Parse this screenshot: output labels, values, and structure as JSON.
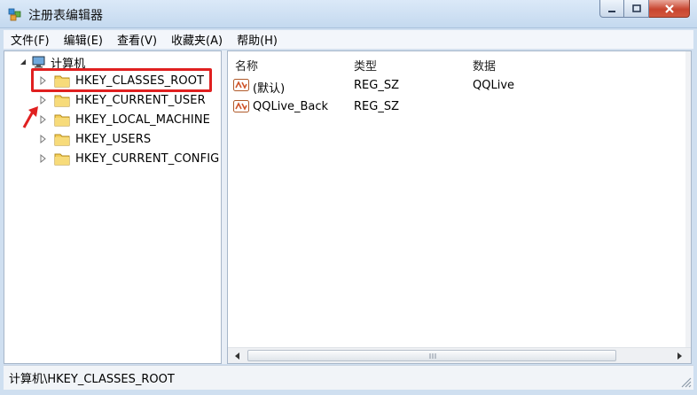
{
  "window": {
    "title": "注册表编辑器"
  },
  "menu": {
    "items": [
      {
        "label": "文件(F)"
      },
      {
        "label": "编辑(E)"
      },
      {
        "label": "查看(V)"
      },
      {
        "label": "收藏夹(A)"
      },
      {
        "label": "帮助(H)"
      }
    ]
  },
  "tree": {
    "root_label": "计算机",
    "items": [
      {
        "label": "HKEY_CLASSES_ROOT",
        "selected": true
      },
      {
        "label": "HKEY_CURRENT_USER"
      },
      {
        "label": "HKEY_LOCAL_MACHINE"
      },
      {
        "label": "HKEY_USERS"
      },
      {
        "label": "HKEY_CURRENT_CONFIG"
      }
    ]
  },
  "list": {
    "columns": [
      "名称",
      "类型",
      "数据"
    ],
    "rows": [
      {
        "name": "(默认)",
        "type": "REG_SZ",
        "data": "QQLive"
      },
      {
        "name": "QQLive_Back",
        "type": "REG_SZ",
        "data": ""
      }
    ]
  },
  "status": {
    "path": "计算机\\HKEY_CLASSES_ROOT"
  },
  "colors": {
    "highlight": "#e02020",
    "accent": "#2b6cb0"
  },
  "icons": {
    "app": "registry-editor-icon",
    "folder": "folder-icon",
    "computer": "computer-icon",
    "string_value": "string-value-icon"
  }
}
